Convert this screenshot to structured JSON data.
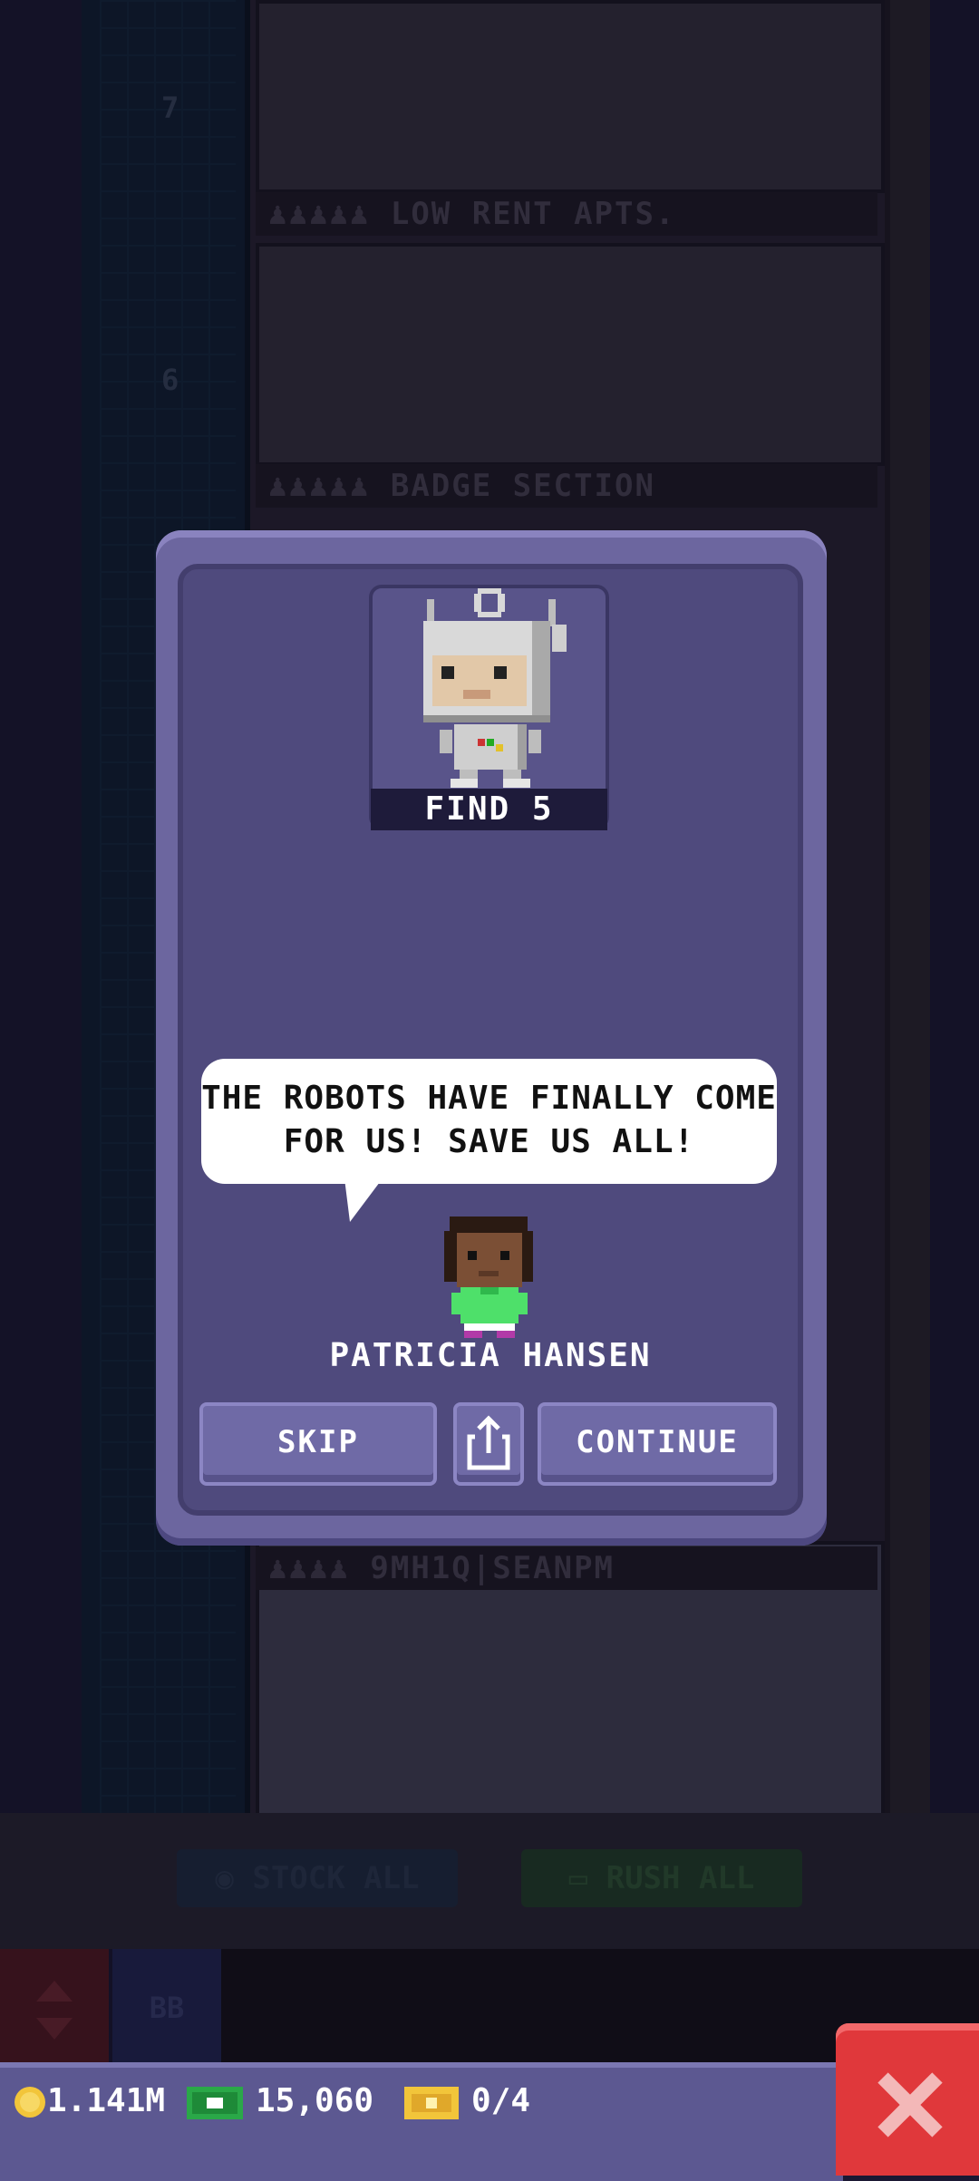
{
  "background": {
    "floor_numbers": [
      "7",
      "6"
    ],
    "floors": [
      {
        "label": "LOW RENT APTS."
      },
      {
        "label": "BADGE SECTION"
      },
      {
        "label": "9MH1Q|SEANPM"
      }
    ],
    "buttons": {
      "stock_all": "STOCK ALL",
      "rush_all": "RUSH ALL",
      "bb": "BB"
    }
  },
  "dialog": {
    "badge": {
      "label": "FIND 5",
      "icon": "robot-icon"
    },
    "speech": "THE ROBOTS HAVE FINALLY COME FOR US! SAVE US ALL!",
    "character_name": "PATRICIA HANSEN",
    "buttons": {
      "skip": "SKIP",
      "continue": "CONTINUE",
      "share_icon": "share-icon"
    }
  },
  "status_bar": {
    "coins": "1.141M",
    "bux": "15,060",
    "tickets": "0/4"
  },
  "colors": {
    "dialog_bg": "#4f4a7d",
    "button_bg": "#6f6aa6",
    "close_red": "#e0383b",
    "bux_green": "#2aa848",
    "coin_gold": "#f2c53a"
  }
}
